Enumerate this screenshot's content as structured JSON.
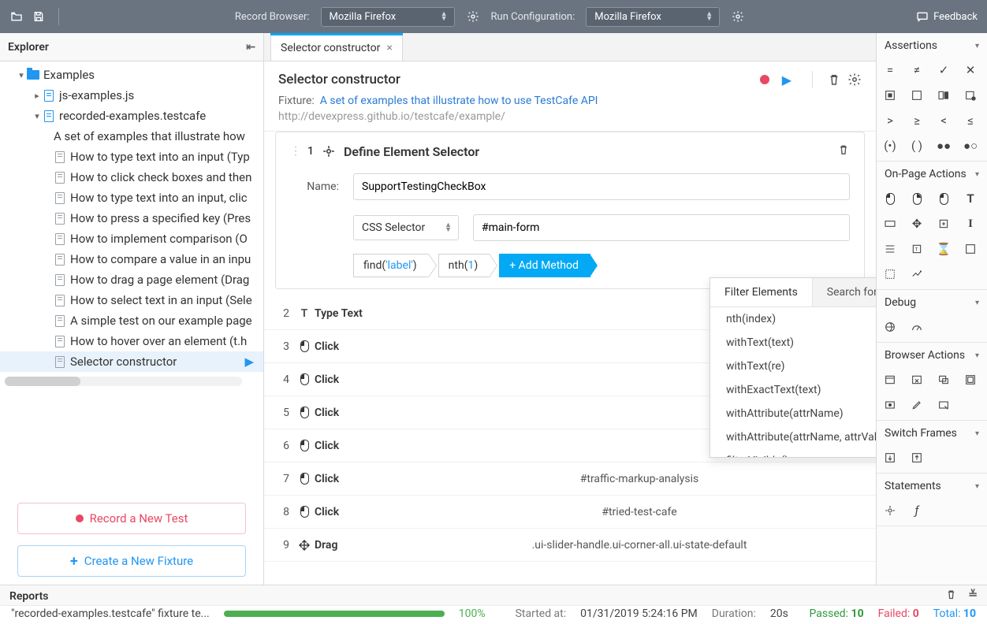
{
  "topbar": {
    "record_browser_label": "Record Browser:",
    "record_browser_value": "Mozilla Firefox",
    "run_config_label": "Run Configuration:",
    "run_config_value": "Mozilla Firefox",
    "feedback": "Feedback"
  },
  "explorer": {
    "title": "Explorer",
    "root": "Examples",
    "file1": "js-examples.js",
    "file2": "recorded-examples.testcafe",
    "fixture_desc": "A set of examples that illustrate how",
    "tests": [
      "How to type text into an input (Typ",
      "How to click check boxes and then",
      "How to type text into an input, clic",
      "How to press a specified key (Pres",
      "How to implement comparison (O",
      "How to compare a value in an inpu",
      "How to drag a page element (Drag",
      "How to select text in an input (Sele",
      "A simple test on our example page",
      "How to hover over an element (t.h",
      "Selector constructor"
    ],
    "record_btn": "Record a New Test",
    "new_fixture_btn": "Create a New Fixture"
  },
  "tab": {
    "title": "Selector constructor"
  },
  "editor": {
    "title": "Selector constructor",
    "fixture_label": "Fixture:",
    "fixture_link": "A set of examples that illustrate how to use TestCafe API",
    "url": "http://devexpress.github.io/testcafe/example/",
    "step1": {
      "num": "1",
      "title": "Define Element Selector",
      "name_label": "Name:",
      "name_value": "SupportTestingCheckBox",
      "selector_type": "CSS Selector",
      "selector_value": "#main-form",
      "chip_find_method": "find",
      "chip_find_arg": "'label'",
      "chip_nth_method": "nth",
      "chip_nth_arg": "1",
      "add_method": "Add Method"
    },
    "dropdown": {
      "tab1": "Filter Elements",
      "tab2": "Search for Related Elements",
      "items": [
        "nth(index)",
        "withText(text)",
        "withText(re)",
        "withExactText(text)",
        "withAttribute(attrName)",
        "withAttribute(attrName, attrValue)",
        "filterVisible()"
      ]
    },
    "steps_rest": [
      {
        "n": "2",
        "icon": "text",
        "name": "Type Text",
        "target": ""
      },
      {
        "n": "3",
        "icon": "mouse",
        "name": "Click",
        "target": ""
      },
      {
        "n": "4",
        "icon": "mouse",
        "name": "Click",
        "target": ""
      },
      {
        "n": "5",
        "icon": "mouse",
        "name": "Click",
        "target": ""
      },
      {
        "n": "6",
        "icon": "mouse",
        "name": "Click",
        "target": ""
      },
      {
        "n": "7",
        "icon": "mouse",
        "name": "Click",
        "target": "#traffic-markup-analysis"
      },
      {
        "n": "8",
        "icon": "mouse",
        "name": "Click",
        "target": "#tried-test-cafe"
      },
      {
        "n": "9",
        "icon": "drag",
        "name": "Drag",
        "target": ".ui-slider-handle.ui-corner-all.ui-state-default"
      }
    ]
  },
  "right": {
    "assertions": "Assertions",
    "onpage": "On-Page Actions",
    "debug": "Debug",
    "browser": "Browser Actions",
    "frames": "Switch Frames",
    "statements": "Statements"
  },
  "reports": {
    "title": "Reports",
    "name": "\"recorded-examples.testcafe\" fixture te...",
    "pct": "100%",
    "started_label": "Started at:",
    "started": "01/31/2019 5:24:16 PM",
    "dur_label": "Duration:",
    "dur": "20s",
    "passed_label": "Passed:",
    "passed": "10",
    "failed_label": "Failed:",
    "failed": "0",
    "total_label": "Total:",
    "total": "10"
  }
}
